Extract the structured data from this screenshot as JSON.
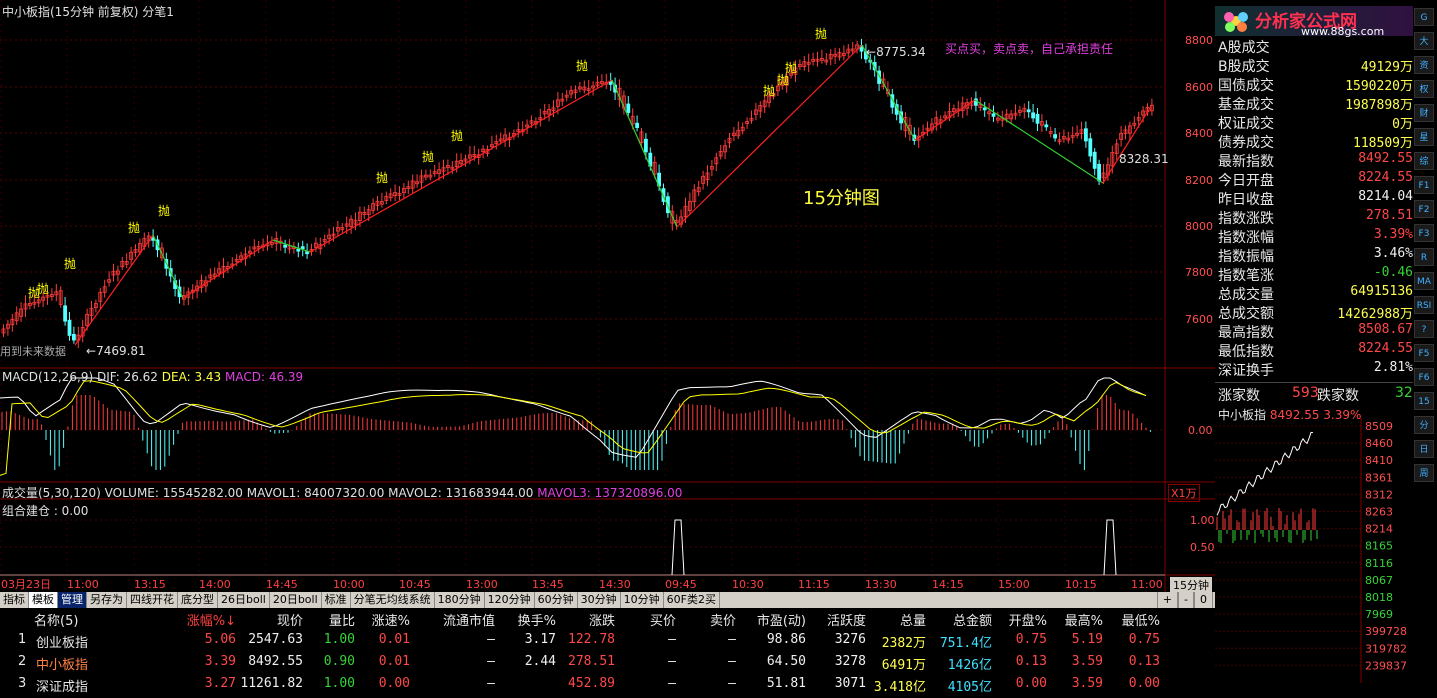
{
  "chart": {
    "header": "中小板指(15分钟 前复权) 分笔1",
    "price_high_label": "8775.34",
    "price_low_label": "7469.81",
    "price_cur_label": "8328.31",
    "future_data_note": "用到未来数据",
    "slogan": "买点买，卖点卖，自己承担责任",
    "center_label": "15分钟图",
    "sell_marker": "抛",
    "price_axis": [
      "8800",
      "8600",
      "8400",
      "8200",
      "8000",
      "7800",
      "7600"
    ],
    "macd_header": {
      "name": "MACD(12,26,9)",
      "dif": "DIF: 26.62",
      "dea": "DEA: 3.43",
      "macd": "MACD: 46.39"
    },
    "macd_zero_label": "0.00",
    "vol_header": {
      "name": "成交量(5,30,120)",
      "volume": "VOLUME: 15545282.00",
      "mavol1": "MAVOL1: 84007320.00",
      "mavol2": "MAVOL2: 131683944.00",
      "mavol3": "MAVOL3: 137320896.00"
    },
    "vol_unit": "X1万",
    "combo_header": "组合建仓 : 0.00",
    "combo_axis": [
      "1.00",
      "0.50"
    ],
    "time_axis": [
      "03月23日",
      "11:00",
      "13:15",
      "14:00",
      "14:45",
      "10:00",
      "10:45",
      "13:00",
      "13:45",
      "14:30",
      "09:45",
      "10:30",
      "11:15",
      "13:30",
      "14:15",
      "15:00",
      "10:15",
      "11:00"
    ],
    "period_label": "15分钟",
    "colors": {
      "up": "#ff3c3c",
      "down": "#54ffff",
      "sell": "#ffff00",
      "ma1": "#ffffff",
      "ma2": "#ffff00",
      "up_trend": "#ff2020",
      "down_trend": "#30d030"
    }
  },
  "tabs": [
    "指标",
    "模板",
    "管理",
    "另存为",
    "四线开花",
    "底分型",
    "26日boll",
    "20日boll",
    "标准",
    "分笔无均线系统",
    "180分钟",
    "120分钟",
    "60分钟",
    "30分钟",
    "10分钟",
    "60F类2买"
  ],
  "tabs_right": [
    "+",
    "-",
    "0"
  ],
  "table": {
    "headers": [
      "名称(5)",
      "涨幅%↓",
      "现价",
      "量比",
      "涨速%",
      "流通市值",
      "换手%",
      "涨跌",
      "买价",
      "卖价",
      "市盈(动)",
      "活跃度",
      "总量",
      "总金额",
      "开盘%",
      "最高%",
      "最低%"
    ],
    "rows": [
      [
        "1",
        "创业板指",
        "5.06",
        "2547.63",
        "1.00",
        "0.01",
        "—",
        "3.17",
        "122.78",
        "—",
        "—",
        "98.86",
        "3276",
        "2382万",
        "751.4亿",
        "0.75",
        "5.19",
        "0.75"
      ],
      [
        "2",
        "中小板指",
        "3.39",
        "8492.55",
        "0.90",
        "0.01",
        "—",
        "2.44",
        "278.51",
        "—",
        "—",
        "64.50",
        "3278",
        "6491万",
        "1426亿",
        "0.13",
        "3.59",
        "0.13"
      ],
      [
        "3",
        "深证成指",
        "3.27",
        "11261.82",
        "1.00",
        "0.00",
        "—",
        "",
        "452.89",
        "—",
        "—",
        "51.81",
        "3071",
        "3.418亿",
        "4105亿",
        "0.00",
        "3.59",
        "0.00"
      ]
    ]
  },
  "right": {
    "logo_text": "分析家公式网",
    "logo_url": "www.88gs.com",
    "stats": [
      {
        "label": "A股成交",
        "value": "",
        "cls": "yellow"
      },
      {
        "label": "B股成交",
        "value": "49129万",
        "cls": "yellow"
      },
      {
        "label": "国债成交",
        "value": "1590220万",
        "cls": "yellow"
      },
      {
        "label": "基金成交",
        "value": "1987898万",
        "cls": "yellow"
      },
      {
        "label": "权证成交",
        "value": "0万",
        "cls": "yellow"
      },
      {
        "label": "债券成交",
        "value": "118509万",
        "cls": "yellow"
      },
      {
        "label": "最新指数",
        "value": "8492.55",
        "cls": "red"
      },
      {
        "label": "今日开盘",
        "value": "8224.55",
        "cls": "red"
      },
      {
        "label": "昨日收盘",
        "value": "8214.04",
        "cls": "white"
      },
      {
        "label": "指数涨跌",
        "value": "278.51",
        "cls": "red"
      },
      {
        "label": "指数涨幅",
        "value": "3.39%",
        "cls": "red"
      },
      {
        "label": "指数振幅",
        "value": "3.46%",
        "cls": "white"
      },
      {
        "label": "指数笔涨",
        "value": "-0.46",
        "cls": "green"
      },
      {
        "label": "总成交量",
        "value": "64915136",
        "cls": "yellow"
      },
      {
        "label": "总成交额",
        "value": "14262988万",
        "cls": "yellow"
      },
      {
        "label": "最高指数",
        "value": "8508.67",
        "cls": "red"
      },
      {
        "label": "最低指数",
        "value": "8224.55",
        "cls": "red"
      },
      {
        "label": "深证换手",
        "value": "2.81%",
        "cls": "white"
      }
    ],
    "rise_label": "涨家数",
    "rise_value": "593",
    "fall_label": "跌家数",
    "fall_value": "32",
    "mini_title": "中小板指",
    "mini_price": "8492.55",
    "mini_pct": "3.39%",
    "mini_axis": [
      "8509",
      "8460",
      "8410",
      "8361",
      "8312",
      "8263",
      "8214",
      "8165",
      "8116",
      "8067",
      "8018",
      "7969",
      "399728",
      "319782",
      "239837"
    ],
    "side_buttons": [
      "G",
      "大",
      "资",
      "权",
      "财",
      "星",
      "综",
      "F1",
      "F2",
      "F3",
      "R",
      "MA",
      "RSI",
      "?",
      "F5",
      "F6",
      "15",
      "分",
      "日",
      "周"
    ]
  }
}
